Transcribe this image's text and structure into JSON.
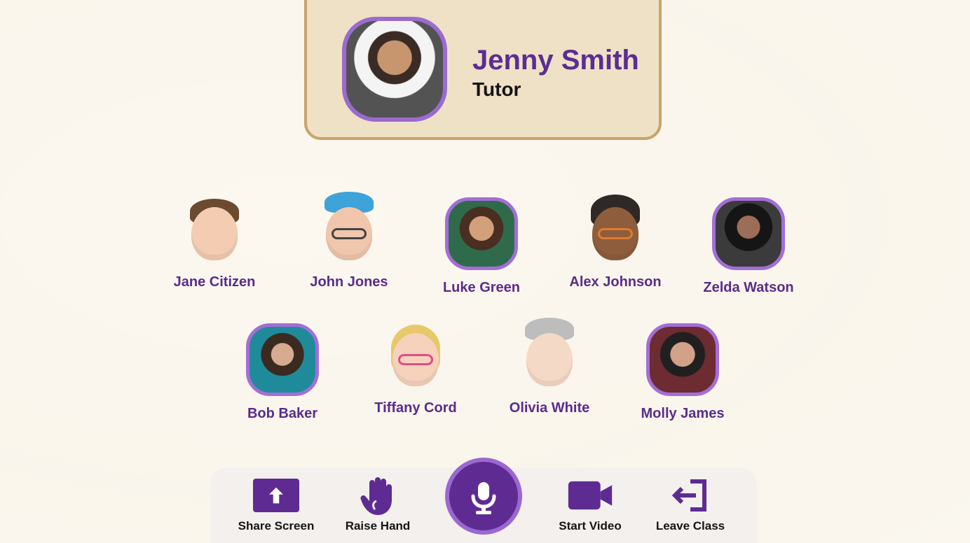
{
  "tutor": {
    "name": "Jenny Smith",
    "role": "Tutor"
  },
  "students": [
    {
      "name": "Jane Citizen",
      "avatar": "memoji-avatar"
    },
    {
      "name": "John Jones",
      "avatar": "memoji-avatar"
    },
    {
      "name": "Luke Green",
      "avatar": "photo-avatar"
    },
    {
      "name": "Alex Johnson",
      "avatar": "memoji-avatar"
    },
    {
      "name": "Zelda Watson",
      "avatar": "photo-avatar"
    },
    {
      "name": "Bob Baker",
      "avatar": "photo-avatar"
    },
    {
      "name": "Tiffany Cord",
      "avatar": "memoji-avatar"
    },
    {
      "name": "Olivia White",
      "avatar": "memoji-avatar"
    },
    {
      "name": "Molly James",
      "avatar": "photo-avatar"
    }
  ],
  "toolbar": {
    "share_screen": "Share Screen",
    "raise_hand": "Raise Hand",
    "start_video": "Start Video",
    "leave_class": "Leave Class"
  },
  "colors": {
    "accent": "#5e2b92",
    "accent_light": "#9b67d0",
    "frame": "#c9a46b"
  },
  "icons": {
    "share": "upload-arrow-icon",
    "hand": "hand-icon",
    "mic": "microphone-icon",
    "video": "video-camera-icon",
    "leave": "leave-door-icon"
  }
}
